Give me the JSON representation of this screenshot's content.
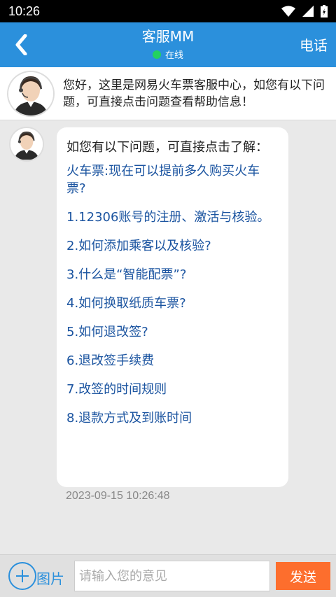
{
  "status_bar": {
    "time": "10:26"
  },
  "header": {
    "title": "客服MM",
    "status": "在线",
    "call_label": "电话",
    "accent_color": "#2b90dc",
    "online_color": "#23d160"
  },
  "notice": {
    "text": "您好，这里是网易火车票客服中心，如您有以下问题，可直接点击问题查看帮助信息！"
  },
  "chat": {
    "intro": "如您有以下问题，可直接点击了解：",
    "questions": [
      "火车票:现在可以提前多久购买火车票?",
      "1.12306账号的注册、激活与核验。",
      "2.如何添加乘客以及核验?",
      "3.什么是“智能配票”?",
      "4.如何换取纸质车票?",
      "5.如何退改签?",
      "6.退改签手续费",
      "7.改签的时间规则",
      "8.退款方式及到账时间"
    ],
    "timestamp": "2023-09-15 10:26:48"
  },
  "input_bar": {
    "image_label": "图片",
    "placeholder": "请输入您的意见",
    "send_label": "发送",
    "send_color": "#fd6e2d"
  }
}
